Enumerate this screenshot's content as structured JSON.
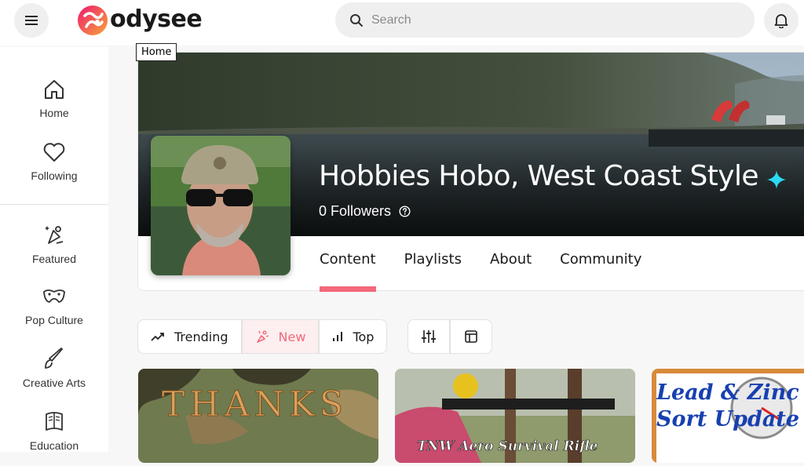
{
  "header": {
    "logo_text": "odysee",
    "search_placeholder": "Search",
    "tooltip": "Home"
  },
  "sidebar": {
    "items": [
      {
        "label": "Home",
        "icon": "home-icon"
      },
      {
        "label": "Following",
        "icon": "heart-icon"
      },
      {
        "label": "Featured",
        "icon": "featured-icon"
      },
      {
        "label": "Pop Culture",
        "icon": "pop-culture-icon"
      },
      {
        "label": "Creative Arts",
        "icon": "brush-icon"
      },
      {
        "label": "Education",
        "icon": "book-icon"
      }
    ]
  },
  "channel": {
    "title": "Hobbies Hobo, West Coast Style",
    "followers": "0 Followers",
    "verified_color": "#2bd9f5"
  },
  "tabs": [
    {
      "label": "Content",
      "active": true
    },
    {
      "label": "Playlists",
      "active": false
    },
    {
      "label": "About",
      "active": false
    },
    {
      "label": "Community",
      "active": false
    }
  ],
  "filters": {
    "trending": "Trending",
    "new": "New",
    "top": "Top",
    "active": "New"
  },
  "thumbnails": [
    {
      "caption": "THANKS"
    },
    {
      "caption": "TNW Aero Survival Rifle"
    },
    {
      "caption": "Lead & Zinc Sort Update"
    }
  ],
  "colors": {
    "accent": "#f2697b",
    "header_bg": "#ffffff",
    "page_bg": "#f7f7f7"
  }
}
